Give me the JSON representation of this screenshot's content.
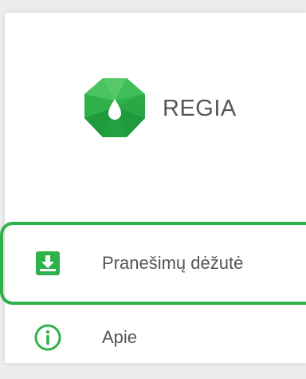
{
  "brand": {
    "name": "REGIA",
    "logo_icon": "regia-logo-icon"
  },
  "nav": {
    "items": [
      {
        "label": "Pranešimų dėžutė",
        "icon": "inbox-download-icon",
        "selected": true
      },
      {
        "label": "Apie",
        "icon": "info-icon",
        "selected": false
      }
    ]
  },
  "colors": {
    "accent": "#2eb34a",
    "accent_dark": "#1f9a3c",
    "text": "#555555",
    "background": "#ececec",
    "panel": "#ffffff"
  }
}
